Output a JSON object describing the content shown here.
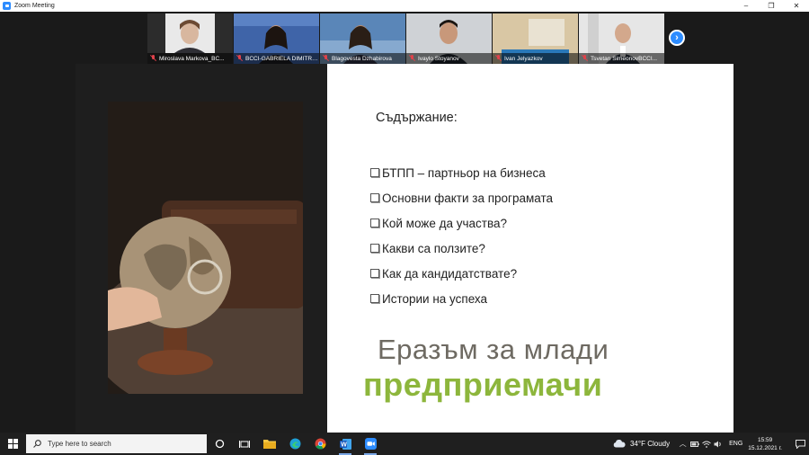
{
  "window": {
    "title": "Zoom Meeting",
    "controls": {
      "minimize": "–",
      "maximize": "❐",
      "close": "✕"
    }
  },
  "participants": [
    {
      "name": "Miroslava Markova_BC...",
      "muted": true,
      "active": false,
      "bg": "#e9e9e9"
    },
    {
      "name": "BCCI-GABRIELA DIMITRO...",
      "muted": true,
      "active": true,
      "bg": "#3f64a8"
    },
    {
      "name": "Blagovesta Dzhabirova",
      "muted": true,
      "active": false,
      "bg": "#5a86b8"
    },
    {
      "name": "Ivaylo Stoyanov",
      "muted": true,
      "active": false,
      "bg": "#cfd2d6"
    },
    {
      "name": "Ivan Jelyazkov",
      "muted": true,
      "active": false,
      "bg": "#d9c7a4"
    },
    {
      "name": "Tsvetan SimeonovBCCI...",
      "muted": true,
      "active": false,
      "bg": "#e6e6e6"
    }
  ],
  "next_arrow": "›",
  "slide": {
    "heading": "Съдържание:",
    "items": [
      "БТПП – партньор на бизнеса",
      "Основни факти за програмата",
      "Кой може да участва?",
      "Какви са ползите?",
      "Как да кандидатствате?",
      "Истории на успеха"
    ],
    "title_line1": "Еразъм за млади",
    "title_line2": "предприемачи",
    "colors": {
      "title1": "#6e6a62",
      "title2": "#8db63c"
    }
  },
  "taskbar": {
    "search_placeholder": "Type here to search",
    "weather": "34°F  Cloudy",
    "language": "ENG",
    "time": "15:59",
    "date": "15.12.2021 г.",
    "apps": [
      "task-view-icon",
      "file-explorer-icon",
      "edge-icon",
      "chrome-icon",
      "word-icon",
      "zoom-icon"
    ]
  }
}
